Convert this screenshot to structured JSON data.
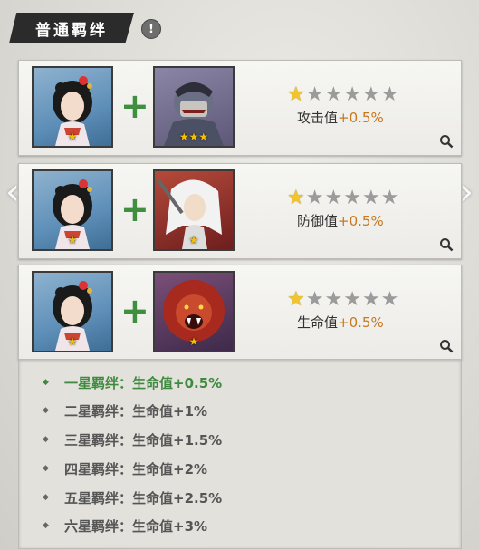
{
  "header": {
    "title": "普通羁绊"
  },
  "nav": {
    "prev": "‹",
    "next": "›"
  },
  "cards": [
    {
      "partner_icon": "masked-ogre-portrait",
      "partner_stars": "★★★",
      "hero_stars": "★",
      "stars_filled": 1,
      "stars_total": 6,
      "attr": "攻击值",
      "value": "+0.5%"
    },
    {
      "partner_icon": "white-haired-swordsman-portrait",
      "partner_stars": "★",
      "hero_stars": "★",
      "stars_filled": 1,
      "stars_total": 6,
      "attr": "防御值",
      "value": "+0.5%"
    },
    {
      "partner_icon": "red-lion-beast-portrait",
      "partner_stars": "★",
      "hero_stars": "★",
      "stars_filled": 1,
      "stars_total": 6,
      "attr": "生命值",
      "value": "+0.5%"
    }
  ],
  "effects": [
    {
      "label": "一星羁绊：生命值+0.5%",
      "active": true
    },
    {
      "label": "二星羁绊：生命值+1%",
      "active": false
    },
    {
      "label": "三星羁绊：生命值+1.5%",
      "active": false
    },
    {
      "label": "四星羁绊：生命值+2%",
      "active": false
    },
    {
      "label": "五星羁绊：生命值+2.5%",
      "active": false
    },
    {
      "label": "六星羁绊：生命值+3%",
      "active": false
    }
  ],
  "colors": {
    "active": "#3f8a3f",
    "inactive": "#555555",
    "value": "#c9771f",
    "star_on": "#f2c52c",
    "star_off": "#9b9b9b"
  }
}
